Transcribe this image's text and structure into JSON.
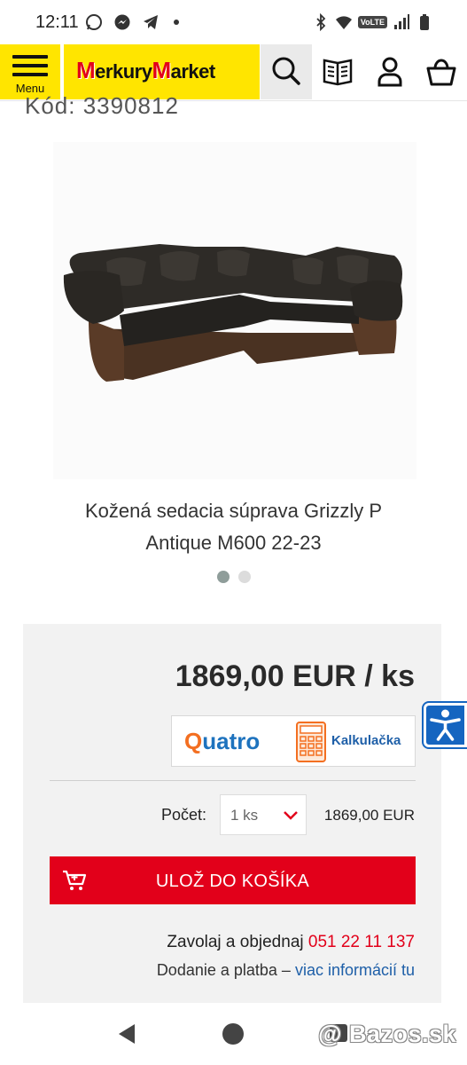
{
  "status_bar": {
    "time": "12:11",
    "left_icons": [
      "whatsapp-icon",
      "messenger-icon",
      "telegram-icon",
      "dot-icon"
    ],
    "right_icons": [
      "bluetooth-icon",
      "wifi-icon",
      "volte-icon",
      "signal-icon",
      "battery-icon"
    ],
    "volte_label": "VoLTE"
  },
  "header": {
    "menu_label": "Menu",
    "logo_text_1": "erkury",
    "logo_text_2": "arket",
    "logo_letter": "M",
    "colors": {
      "brand_yellow": "#ffe500",
      "brand_red": "#e2001a"
    }
  },
  "product": {
    "code": "Kód: 3390812",
    "title_line1": "Kožená sedacia súprava Grizzly P",
    "title_line2": "Antique M600 22-23",
    "image_alt": "leather corner sofa"
  },
  "carousel": {
    "active_index": 0,
    "count": 2
  },
  "price_box": {
    "price": "1869,00 EUR / ks",
    "quatro_name_q": "Q",
    "quatro_name_rest": "uatro",
    "quatro_label": "Kalkulačka",
    "count_label": "Počet:",
    "count_value": "1 ks",
    "count_total": "1869,00 EUR",
    "cart_button": "ULOŽ DO KOŠÍKA",
    "call_text": "Zavolaj a objednaj",
    "phone": "051 22 11 137",
    "delivery_text": "Dodanie a platba –",
    "delivery_link": "viac informácií tu"
  },
  "watermark": "@ Bazos.sk"
}
